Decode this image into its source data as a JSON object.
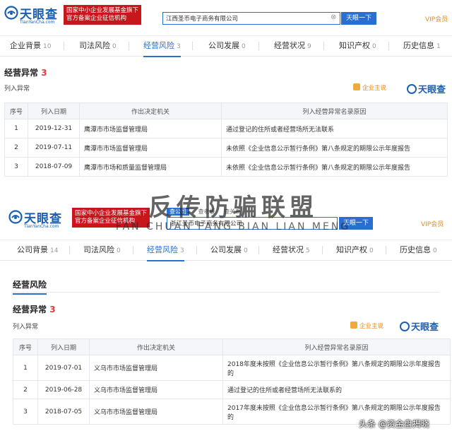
{
  "screens": [
    {
      "logo": {
        "name": "天眼查",
        "sub": "TianYanCha.com"
      },
      "banner_lines": [
        "国家中小企业发展基金旗下",
        "官方备案企业征信机构"
      ],
      "search": {
        "value": "江西圣币电子商务有限公司",
        "button": "天眼一下",
        "tabs": []
      },
      "vip": "VIP会员",
      "nav_tabs": [
        {
          "label": "企业背景",
          "count": "10"
        },
        {
          "label": "司法风险",
          "count": "0"
        },
        {
          "label": "经营风险",
          "count": "3"
        },
        {
          "label": "公司发展",
          "count": "0"
        },
        {
          "label": "经营状况",
          "count": "9"
        },
        {
          "label": "知识产权",
          "count": "0"
        },
        {
          "label": "历史信息",
          "count": "1"
        }
      ],
      "heading": "",
      "section_title": "经营异常",
      "section_count": "3",
      "sub_label": "列入异常",
      "partner_label": "企业主说",
      "watermark_logo": "天眼查",
      "table": {
        "headers": [
          "序号",
          "列入日期",
          "作出决定机关",
          "列入经营异常名录原因"
        ],
        "rows": [
          {
            "no": "1",
            "date": "2019-12-31",
            "authority": "鹰潭市市场监督管理局",
            "reason": "通过登记的住所或者经营场所无法联系"
          },
          {
            "no": "2",
            "date": "2019-07-11",
            "authority": "鹰潭市市场监督管理局",
            "reason": "未依照《企业信息公示暂行条例》第八条规定的期限公示年度报告"
          },
          {
            "no": "3",
            "date": "2018-07-09",
            "authority": "鹰潭市市场和质量监督管理局",
            "reason": "未依照《企业信息公示暂行条例》第八条规定的期限公示年度报告"
          }
        ]
      }
    },
    {
      "logo": {
        "name": "天眼查",
        "sub": "TianYanCha.com"
      },
      "banner_lines": [
        "国家中小企业发展基金旗下",
        "官方备案企业征信机构"
      ],
      "search": {
        "value": "浙江圣币电子商务有限公司",
        "button": "天眼一下",
        "tabs": [
          "查公司",
          "查老板",
          "查关系"
        ]
      },
      "vip": "VIP会员",
      "nav_tabs": [
        {
          "label": "公司背景",
          "count": "14"
        },
        {
          "label": "司法风险",
          "count": "0"
        },
        {
          "label": "经营风险",
          "count": "3"
        },
        {
          "label": "公司发展",
          "count": "0"
        },
        {
          "label": "经营状况",
          "count": "5"
        },
        {
          "label": "知识产权",
          "count": "0"
        },
        {
          "label": "历史信息",
          "count": "0"
        }
      ],
      "heading": "经营风险",
      "section_title": "经营异常",
      "section_count": "3",
      "sub_label": "列入异常",
      "partner_label": "企业主说",
      "watermark_logo": "天眼查",
      "table": {
        "headers": [
          "序号",
          "列入日期",
          "作出决定机关",
          "列入经营异常名录原因"
        ],
        "rows": [
          {
            "no": "1",
            "date": "2019-07-01",
            "authority": "义乌市市场监督管理局",
            "reason": "2018年度未按照《企业信息公示暂行条例》第八条规定的期限公示年度报告的"
          },
          {
            "no": "2",
            "date": "2019-06-28",
            "authority": "义乌市市场监督管理局",
            "reason": "通过登记的住所或者经营场所无法联系的"
          },
          {
            "no": "3",
            "date": "2018-07-05",
            "authority": "义乌市市场监督管理局",
            "reason": "2017年度未按照《企业信息公示暂行条例》第八条规定的期限公示年度报告的"
          }
        ]
      }
    }
  ],
  "overlay": {
    "title": "反传防骗联盟",
    "pinyin": "FAN CHUAN FANG BIAN LIAN MENG",
    "footer_mark": "头条 @资金盘揭晓"
  },
  "colors": {
    "brand": "#1a5fb4",
    "accent": "#2a6ed0",
    "red": "#c8161d",
    "orange": "#e58a1f",
    "count_red": "#e03c3c"
  }
}
